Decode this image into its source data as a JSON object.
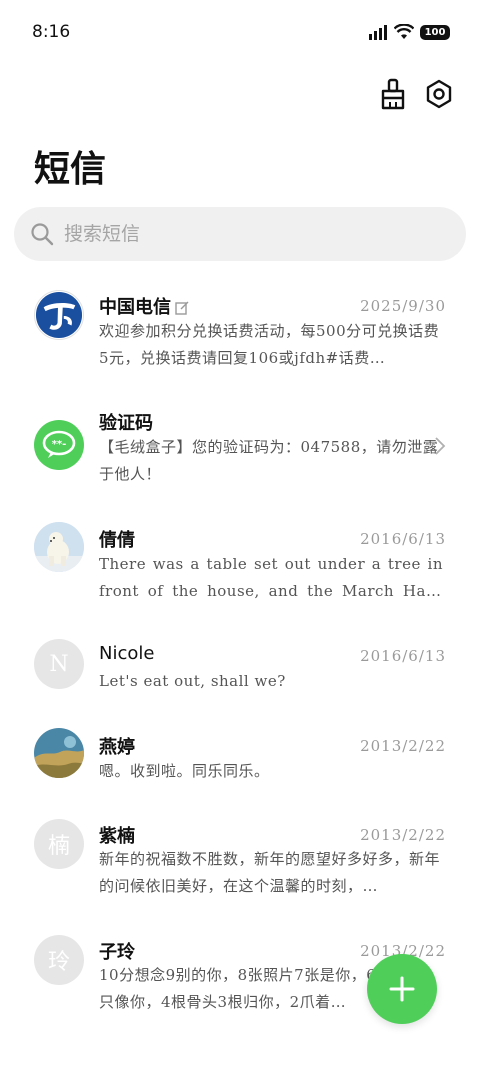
{
  "status": {
    "time": "8:16",
    "battery": "100"
  },
  "header": {
    "title": "短信"
  },
  "search": {
    "placeholder": "搜索短信"
  },
  "conversations": [
    {
      "name": "中国电信",
      "date": "2025/9/30",
      "preview": "欢迎参加积分兑换话费活动，每500分可兑换话费5元，兑换话费请回复106或jfdh#话费…",
      "avatar": "telecom-logo-icon"
    },
    {
      "name": "验证码",
      "date": "",
      "preview": "【毛绒盒子】您的验证码为：047588，请勿泄露于他人！",
      "avatar": "message-bubble-icon"
    },
    {
      "name": "倩倩",
      "date": "2016/6/13",
      "preview": "There was a table set out under a tree in front of the house, and the March Hare a…",
      "avatar": "polar-bear-photo"
    },
    {
      "name": "Nicole",
      "date": "2016/6/13",
      "preview": "Let's eat out, shall we?",
      "avatar_letter": "N"
    },
    {
      "name": "燕婷",
      "date": "2013/2/22",
      "preview": "嗯。收到啦。同乐同乐。",
      "avatar": "landscape-photo"
    },
    {
      "name": "紫楠",
      "date": "2013/2/22",
      "preview": "新年的祝福数不胜数，新年的愿望好多好多，新年的问候依旧美好，在这个温馨的时刻，…",
      "avatar_letter": "楠"
    },
    {
      "name": "子玲",
      "date": "2013/2/22",
      "preview": "10分想念9别的你，8张照片7张是你，6只小狗5只像你，4根骨头3根归你，2爪着…",
      "avatar_letter": "玲"
    }
  ],
  "colors": {
    "accent": "#4fcf5a",
    "telecom": "#1a4fa0",
    "date": "#9a9a9a"
  }
}
